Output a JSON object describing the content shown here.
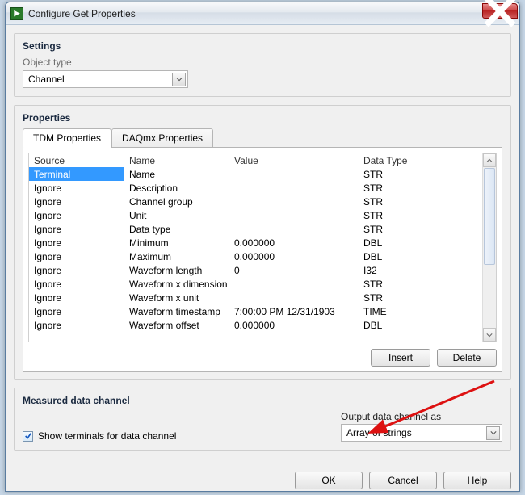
{
  "window": {
    "title": "Configure Get Properties"
  },
  "settings": {
    "title": "Settings",
    "object_type_label": "Object type",
    "object_type_value": "Channel"
  },
  "properties": {
    "title": "Properties",
    "tabs": {
      "active": "TDM Properties",
      "inactive": "DAQmx Properties"
    },
    "columns": {
      "source": "Source",
      "name": "Name",
      "value": "Value",
      "datatype": "Data Type"
    },
    "rows": [
      {
        "source": "Terminal",
        "name": "Name",
        "value": "",
        "datatype": "STR",
        "selected": true
      },
      {
        "source": "Ignore",
        "name": "Description",
        "value": "",
        "datatype": "STR"
      },
      {
        "source": "Ignore",
        "name": "Channel group",
        "value": "",
        "datatype": "STR"
      },
      {
        "source": "Ignore",
        "name": "Unit",
        "value": "",
        "datatype": "STR"
      },
      {
        "source": "Ignore",
        "name": "Data type",
        "value": "",
        "datatype": "STR"
      },
      {
        "source": "Ignore",
        "name": "Minimum",
        "value": "0.000000",
        "datatype": "DBL"
      },
      {
        "source": "Ignore",
        "name": "Maximum",
        "value": "0.000000",
        "datatype": "DBL"
      },
      {
        "source": "Ignore",
        "name": "Waveform length",
        "value": "0",
        "datatype": "I32"
      },
      {
        "source": "Ignore",
        "name": "Waveform x dimension",
        "value": "",
        "datatype": "STR"
      },
      {
        "source": "Ignore",
        "name": "Waveform x unit",
        "value": "",
        "datatype": "STR"
      },
      {
        "source": "Ignore",
        "name": "Waveform timestamp",
        "value": "7:00:00 PM 12/31/1903",
        "datatype": "TIME"
      },
      {
        "source": "Ignore",
        "name": "Waveform offset",
        "value": "0.000000",
        "datatype": "DBL"
      }
    ],
    "buttons": {
      "insert": "Insert",
      "delete": "Delete"
    }
  },
  "measured": {
    "title": "Measured data channel",
    "checkbox_label": "Show terminals for data channel",
    "checkbox_checked": true,
    "output_label": "Output data channel as",
    "output_value": "Array of strings"
  },
  "footer": {
    "ok": "OK",
    "cancel": "Cancel",
    "help": "Help"
  }
}
